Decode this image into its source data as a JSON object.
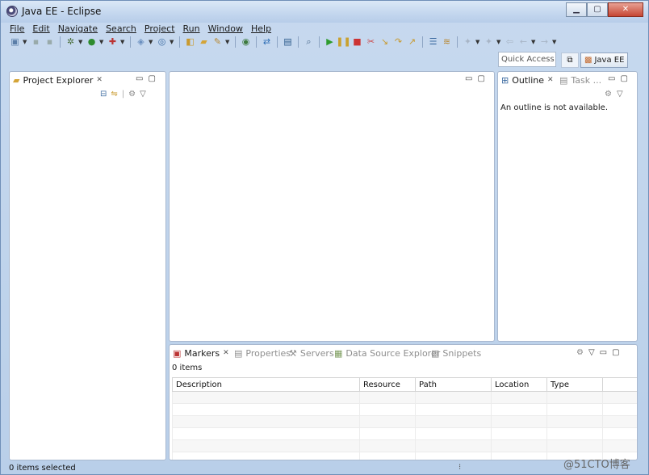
{
  "window": {
    "title": "Java EE - Eclipse",
    "minimize": "▁",
    "maximize": "▢",
    "close": "✕"
  },
  "menu": [
    "File",
    "Edit",
    "Navigate",
    "Search",
    "Project",
    "Run",
    "Window",
    "Help"
  ],
  "quick_access": {
    "placeholder": "Quick Access"
  },
  "perspective": {
    "label": "Java EE"
  },
  "project_explorer": {
    "title": "Project Explorer"
  },
  "outline": {
    "title": "Outline",
    "other_tab": "Task ...",
    "message": "An outline is not available."
  },
  "bottom": {
    "tabs": [
      "Markers",
      "Properties",
      "Servers",
      "Data Source Explorer",
      "Snippets"
    ],
    "count": "0 items",
    "columns": [
      "Description",
      "Resource",
      "Path",
      "Location",
      "Type"
    ]
  },
  "status": {
    "text": "0 items selected"
  },
  "watermark": "@51CTO博客",
  "colors": {
    "frame": "#c7d9ef",
    "accent": "#4a7ab8",
    "panel_border": "#a8b8cf"
  }
}
